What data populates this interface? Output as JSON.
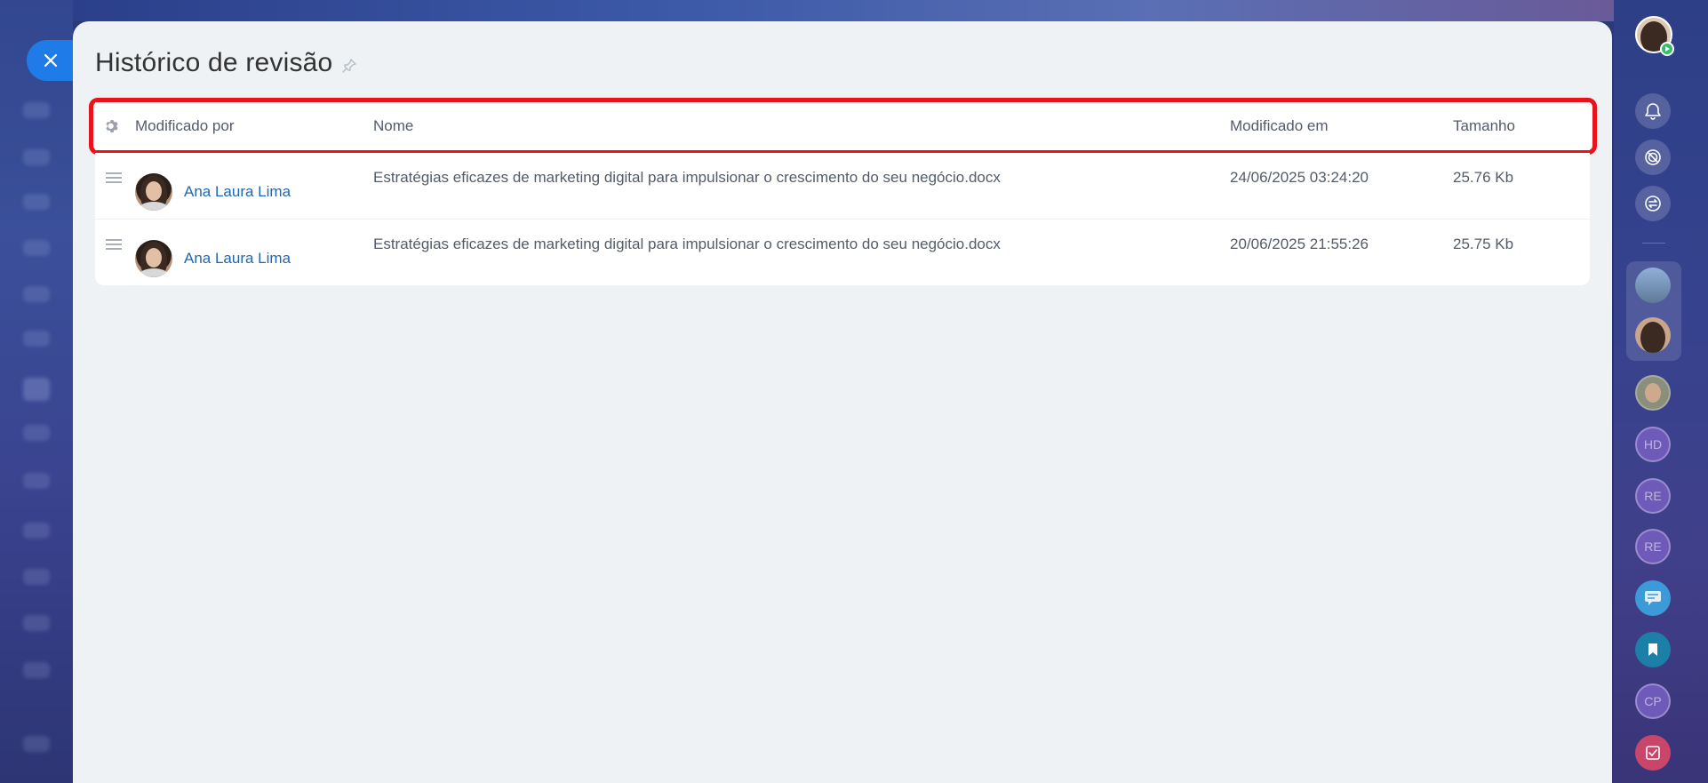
{
  "panel": {
    "title": "Histórico de revisão"
  },
  "table": {
    "columns": {
      "user": "Modificado por",
      "name": "Nome",
      "date": "Modificado em",
      "size": "Tamanho"
    },
    "rows": [
      {
        "user": "Ana Laura Lima",
        "name": "Estratégias eficazes de marketing digital para impulsionar o crescimento do seu negócio.docx",
        "date": "24/06/2025 03:24:20",
        "size": "25.76 Kb"
      },
      {
        "user": "Ana Laura Lima",
        "name": "Estratégias eficazes de marketing digital para impulsionar o crescimento do seu negócio.docx",
        "date": "20/06/2025 21:55:26",
        "size": "25.75 Kb"
      }
    ]
  },
  "sidebar": {
    "initials": [
      "HD",
      "RE",
      "RE",
      "CP"
    ]
  },
  "colors": {
    "accent": "#1f7be8",
    "highlight": "#e8141c",
    "link": "#2067b0",
    "online": "#2fc26b"
  }
}
